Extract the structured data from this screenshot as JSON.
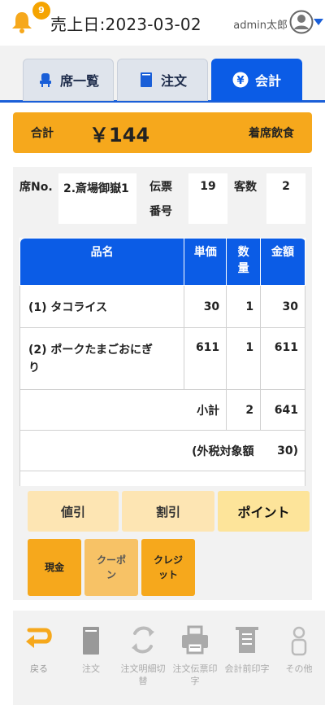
{
  "header": {
    "notification_count": "9",
    "sales_date": "売上日:2023-03-02",
    "user_name": "admin太郎"
  },
  "tabs": [
    {
      "label": "席一覧",
      "icon": "seat-icon",
      "active": false
    },
    {
      "label": "注文",
      "icon": "book-icon",
      "active": false
    },
    {
      "label": "会計",
      "icon": "yen-icon",
      "active": true
    }
  ],
  "total": {
    "label": "合計",
    "amount": "￥144",
    "type": "着席飲食"
  },
  "info": {
    "seat_label": "席No.",
    "seat_value": "2.斎場御嶽1",
    "slip_label_1": "伝票",
    "slip_label_2": "番号",
    "slip_value": "19",
    "guests_label": "客数",
    "guests_value": "2"
  },
  "table": {
    "headers": {
      "name": "品名",
      "price": "単価",
      "qty_1": "数",
      "qty_2": "量",
      "amount": "金額"
    },
    "rows": [
      {
        "name": "(1) タコライス",
        "price": "30",
        "qty": "1",
        "amount": "30"
      },
      {
        "name_1": "(2) ポークたまごおにぎ",
        "name_2": "り",
        "price": "611",
        "qty": "1",
        "amount": "611"
      }
    ],
    "subtotal": {
      "label": "小計",
      "qty": "2",
      "amount": "641"
    },
    "taxable": {
      "label": "(外税対象額",
      "amount": "30)"
    }
  },
  "actions": {
    "discount_value": "値引",
    "discount_rate": "割引",
    "point": "ポイント",
    "cash": "現金",
    "coupon_1": "クーポ",
    "coupon_2": "ン",
    "credit_1": "クレジ",
    "credit_2": "ット"
  },
  "toolbar": {
    "back": "戻る",
    "order": "注文",
    "print_detail_1": "注文明細切",
    "print_detail_2": "替",
    "print_slip_1": "注文伝票印",
    "print_slip_2": "字",
    "print_pre_bill": "会計前印字",
    "other": "その他"
  },
  "colors": {
    "accent_blue": "#0b5ce6",
    "accent_orange": "#f6a81c"
  }
}
